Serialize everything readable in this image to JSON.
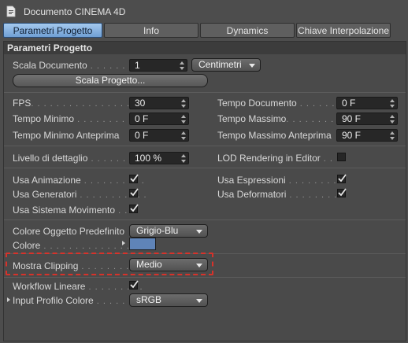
{
  "window": {
    "title": "Documento CINEMA 4D"
  },
  "tabs": [
    {
      "label": "Parametri Progetto",
      "active": true
    },
    {
      "label": "Info",
      "active": false
    },
    {
      "label": "Dynamics",
      "active": false
    },
    {
      "label": "Chiave Interpolazione",
      "active": false
    }
  ],
  "section": {
    "title": "Parametri Progetto"
  },
  "scala": {
    "label": "Scala Documento",
    "dots": " . . . . . . . .",
    "value": "1",
    "unit": "Centimetri",
    "button_label": "Scala Progetto..."
  },
  "time": {
    "fps": {
      "label": "FPS",
      "dots": ". . . . . . . . . . . . . . . . . .",
      "value": "30"
    },
    "tempo_minimo": {
      "label": "Tempo Minimo",
      "dots": " . . . . . . . . . .",
      "value": "0 F"
    },
    "tempo_minimo_anteprima": {
      "label": "Tempo Minimo Anteprima",
      "dots": "",
      "value": "0 F"
    },
    "tempo_documento": {
      "label": "Tempo Documento",
      "dots": " . . . . . . .",
      "value": "0 F"
    },
    "tempo_massimo": {
      "label": "Tempo Massimo",
      "dots": ". . . . . . . . .",
      "value": "90 F"
    },
    "tempo_massimo_anteprima": {
      "label": "Tempo Massimo Anteprima",
      "dots": "",
      "value": "90 F"
    }
  },
  "lod": {
    "livello": {
      "label": "Livello di dettaglio",
      "dots": " . . . . . . .",
      "value": "100 %"
    },
    "rendering": {
      "label": "LOD Rendering in Editor",
      "dots": " . .",
      "checked": false
    }
  },
  "usage": {
    "animazione": {
      "label": "Usa Animazione",
      "dots": " . . . . . . . . . .",
      "checked": true
    },
    "generatori": {
      "label": "Usa Generatori",
      "dots": " . . . . . . . . . . .",
      "checked": true
    },
    "sistema_movimento": {
      "label": "Usa Sistema Movimento",
      "dots": " . .",
      "checked": true
    },
    "espressioni": {
      "label": "Usa Espressioni",
      "dots": " . . . . . . . . .",
      "checked": true
    },
    "deformatori": {
      "label": "Usa Deformatori",
      "dots": " . . . . . . . .",
      "checked": true
    }
  },
  "colors": {
    "colore_oggetto": {
      "label": "Colore Oggetto Predefinito",
      "value": "Grigio-Blu"
    },
    "colore": {
      "label": "Colore",
      "dots": " . . . . . . . . . . . . . . . . . .",
      "swatch": "#5f84b8"
    }
  },
  "clipping": {
    "label": "Mostra Clipping",
    "dots": " . . . . . . . . . .",
    "value": "Medio"
  },
  "workflow": {
    "lineare": {
      "label": "Workflow Lineare",
      "dots": " . . . . . . . . .",
      "checked": true
    },
    "profilo": {
      "label": "Input Profilo Colore",
      "dots": " . . . . . . .",
      "value": "sRGB"
    }
  },
  "accent": {
    "highlight": "#d8322a",
    "active_tab": "#8db6e3"
  }
}
